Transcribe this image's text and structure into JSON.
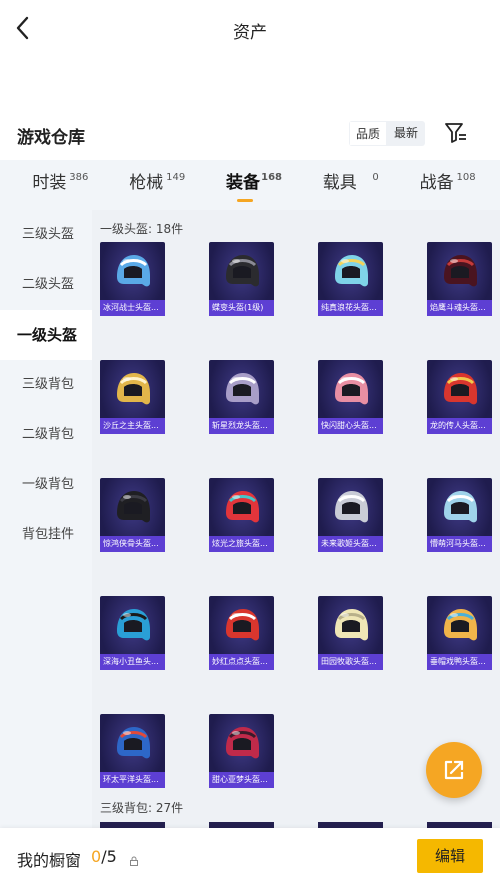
{
  "header": {
    "title": "资产"
  },
  "section": {
    "title": "游戏仓库",
    "sort_quality": "品质",
    "sort_latest": "最新"
  },
  "tabs": [
    {
      "label": "时装",
      "count": "386"
    },
    {
      "label": "枪械",
      "count": "149"
    },
    {
      "label": "装备",
      "count": "168"
    },
    {
      "label": "载具",
      "count": "0"
    },
    {
      "label": "战备",
      "count": "108"
    }
  ],
  "leftnav": [
    {
      "label": "三级头盔"
    },
    {
      "label": "二级头盔"
    },
    {
      "label": "一级头盔"
    },
    {
      "label": "三级背包"
    },
    {
      "label": "二级背包"
    },
    {
      "label": "一级背包"
    },
    {
      "label": "背包挂件"
    }
  ],
  "groups": {
    "current": "一级头盔: 18件",
    "next": "三级背包: 27件"
  },
  "items": [
    {
      "name": "冰河战士头盔...",
      "color": "#5aa9e6",
      "trim": "#ffffff"
    },
    {
      "name": "蝶变头盔(1级)",
      "color": "#2b2b2f",
      "trim": "#8b8b95"
    },
    {
      "name": "纯真浪花头盔...",
      "color": "#7fd3e8",
      "trim": "#f2d45c"
    },
    {
      "name": "焰鹰斗魂头盔...",
      "color": "#4a1420",
      "trim": "#c43a3a"
    },
    {
      "name": "沙丘之主头盔...",
      "color": "#e2b64a",
      "trim": "#fff2c9"
    },
    {
      "name": "斩星烈龙头盔...",
      "color": "#a89ec8",
      "trim": "#ffffff"
    },
    {
      "name": "快闪甜心头盔...",
      "color": "#e88fa3",
      "trim": "#ffffff"
    },
    {
      "name": "龙的传人头盔...",
      "color": "#d9362e",
      "trim": "#f2c94c"
    },
    {
      "name": "惊鸿侠骨头盔...",
      "color": "#1f1f23",
      "trim": "#3c3c44"
    },
    {
      "name": "炫光之旅头盔...",
      "color": "#e2353b",
      "trim": "#45c6c9"
    },
    {
      "name": "未来歌姬头盔...",
      "color": "#c9ccd6",
      "trim": "#ffffff"
    },
    {
      "name": "懵萌河马头盔...",
      "color": "#9fd3ea",
      "trim": "#ffffff"
    },
    {
      "name": "深海小丑鱼头...",
      "color": "#2a9fd6",
      "trim": "#1a1a1a"
    },
    {
      "name": "妙红点点头盔...",
      "color": "#d9362e",
      "trim": "#ffffff"
    },
    {
      "name": "田园牧歌头盔...",
      "color": "#efe6b6",
      "trim": "#b8b08a"
    },
    {
      "name": "垂帽戏鸭头盔...",
      "color": "#f0b44a",
      "trim": "#4ab0d9"
    },
    {
      "name": "环太平洋头盔...",
      "color": "#2d67c8",
      "trim": "#e04a3a"
    },
    {
      "name": "甜心亚梦头盔...",
      "color": "#c02a4a",
      "trim": "#3a1a2a"
    }
  ],
  "bottombar": {
    "label": "我的橱窗",
    "count_current": "0",
    "count_total": "/5",
    "edit_label": "编辑"
  }
}
